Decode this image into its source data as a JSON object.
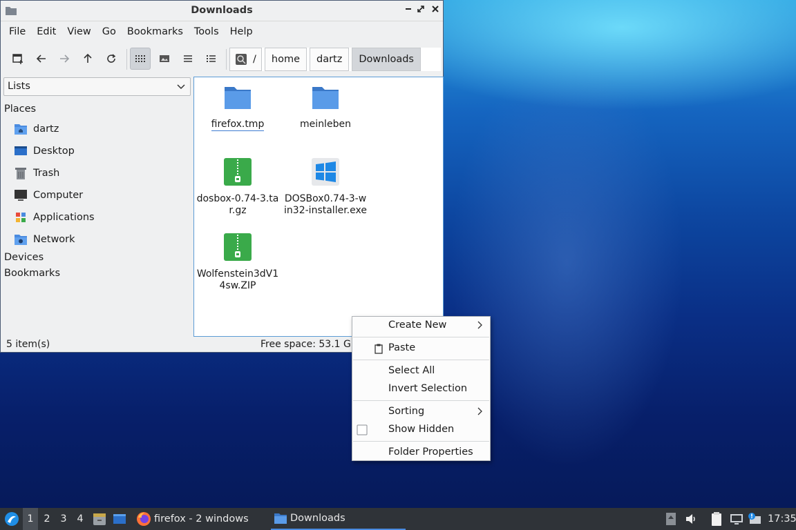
{
  "window": {
    "title": "Downloads"
  },
  "menubar": [
    "File",
    "Edit",
    "View",
    "Go",
    "Bookmarks",
    "Tools",
    "Help"
  ],
  "pathbar": {
    "root": "/",
    "crumbs": [
      "home",
      "dartz",
      "Downloads"
    ]
  },
  "side": {
    "combo_value": "Lists",
    "places_header": "Places",
    "places": [
      "dartz",
      "Desktop",
      "Trash",
      "Computer",
      "Applications",
      "Network"
    ],
    "devices_header": "Devices",
    "bookmarks_header": "Bookmarks"
  },
  "files": [
    {
      "name": "firefox.tmp",
      "type": "folder"
    },
    {
      "name": "meinleben",
      "type": "folder"
    },
    {
      "name": "dosbox-0.74-3.tar.gz",
      "type": "archive"
    },
    {
      "name": "DOSBox0.74-3-win32-installer.exe",
      "type": "exe"
    },
    {
      "name": "Wolfenstein3dV14sw.ZIP",
      "type": "archive"
    }
  ],
  "status": {
    "items": "5 item(s)",
    "free_space": "Free space: 53.1 GiB"
  },
  "context_menu": {
    "create_new": "Create New",
    "paste": "Paste",
    "select_all": "Select All",
    "invert_selection": "Invert Selection",
    "sorting": "Sorting",
    "show_hidden": "Show Hidden",
    "folder_properties": "Folder Properties"
  },
  "taskbar": {
    "workspaces": [
      "1",
      "2",
      "3",
      "4"
    ],
    "tasks": [
      "firefox - 2 windows",
      "Downloads"
    ],
    "clock": "17:35"
  },
  "colors": {
    "folder": "#4a8be0",
    "archive": "#3aaa4a",
    "accent": "#4a8be0",
    "taskbar": "#2f3338"
  }
}
